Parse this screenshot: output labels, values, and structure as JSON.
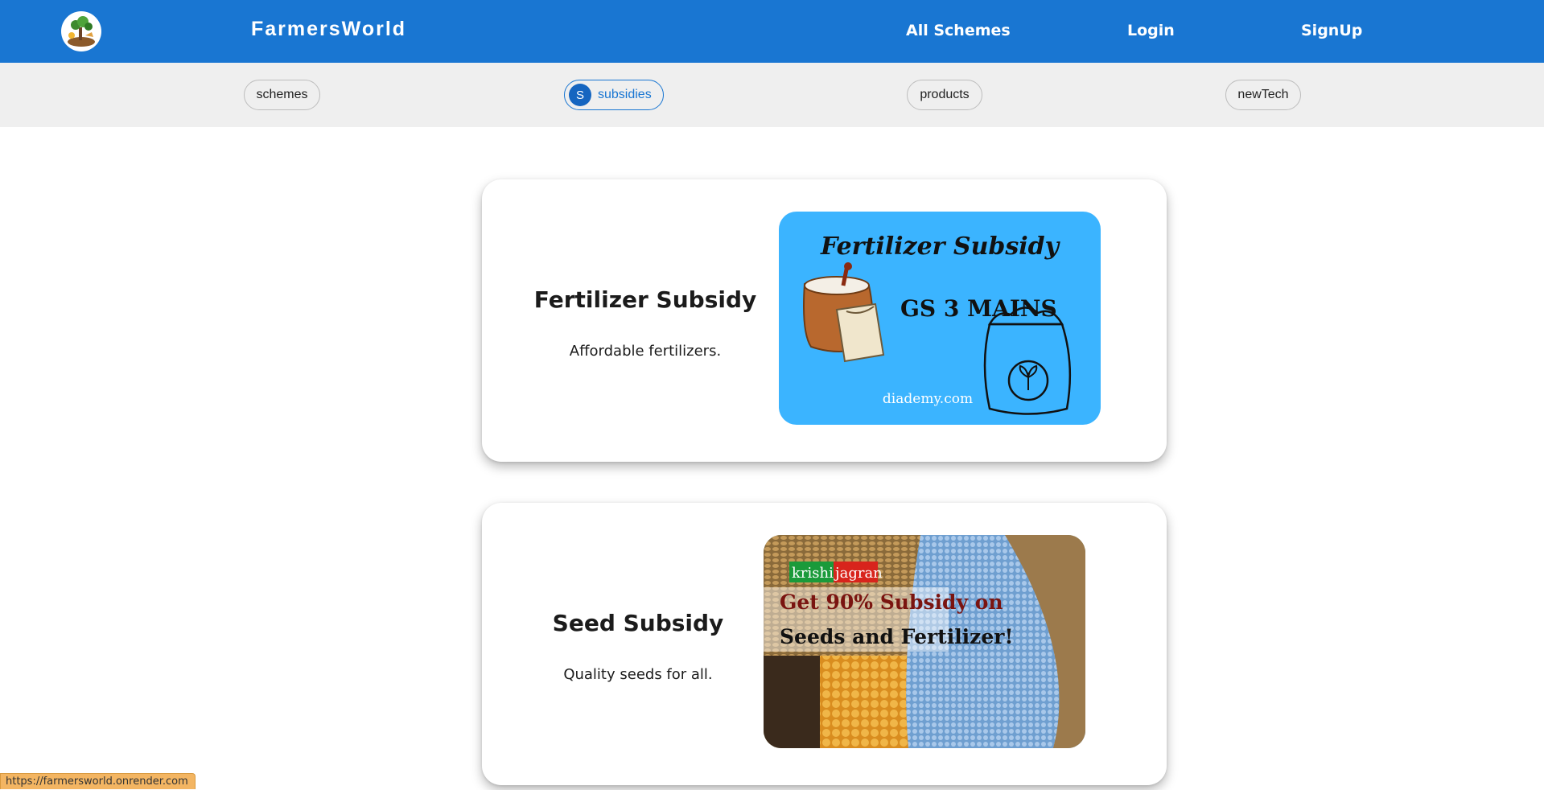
{
  "header": {
    "brand": "FarmersWorld",
    "logo_icon": "farm-logo-icon",
    "bg_color": "#1976d2",
    "nav": [
      {
        "label": "All Schemes"
      },
      {
        "label": "Login"
      },
      {
        "label": "SignUp"
      }
    ]
  },
  "chips": [
    {
      "label": "schemes",
      "active": false
    },
    {
      "label": "subsidies",
      "active": true,
      "avatar": "S"
    },
    {
      "label": "products",
      "active": false
    },
    {
      "label": "newTech",
      "active": false
    }
  ],
  "cards": [
    {
      "title": "Fertilizer Subsidy",
      "description": "Affordable fertilizers.",
      "image": {
        "headline": "Fertilizer Subsidy",
        "caption": "GS 3 MAINS",
        "footer": "diademy.com",
        "bg_color": "#3bb4ff"
      }
    },
    {
      "title": "Seed Subsidy",
      "description": "Quality seeds for all.",
      "image": {
        "brand_part1": "krishi",
        "brand_part2": "jagran",
        "headline_line1": "Get 90% Subsidy on",
        "headline_line2": "Seeds and Fertilizer!"
      }
    }
  ],
  "status_url": "https://farmersworld.onrender.com"
}
